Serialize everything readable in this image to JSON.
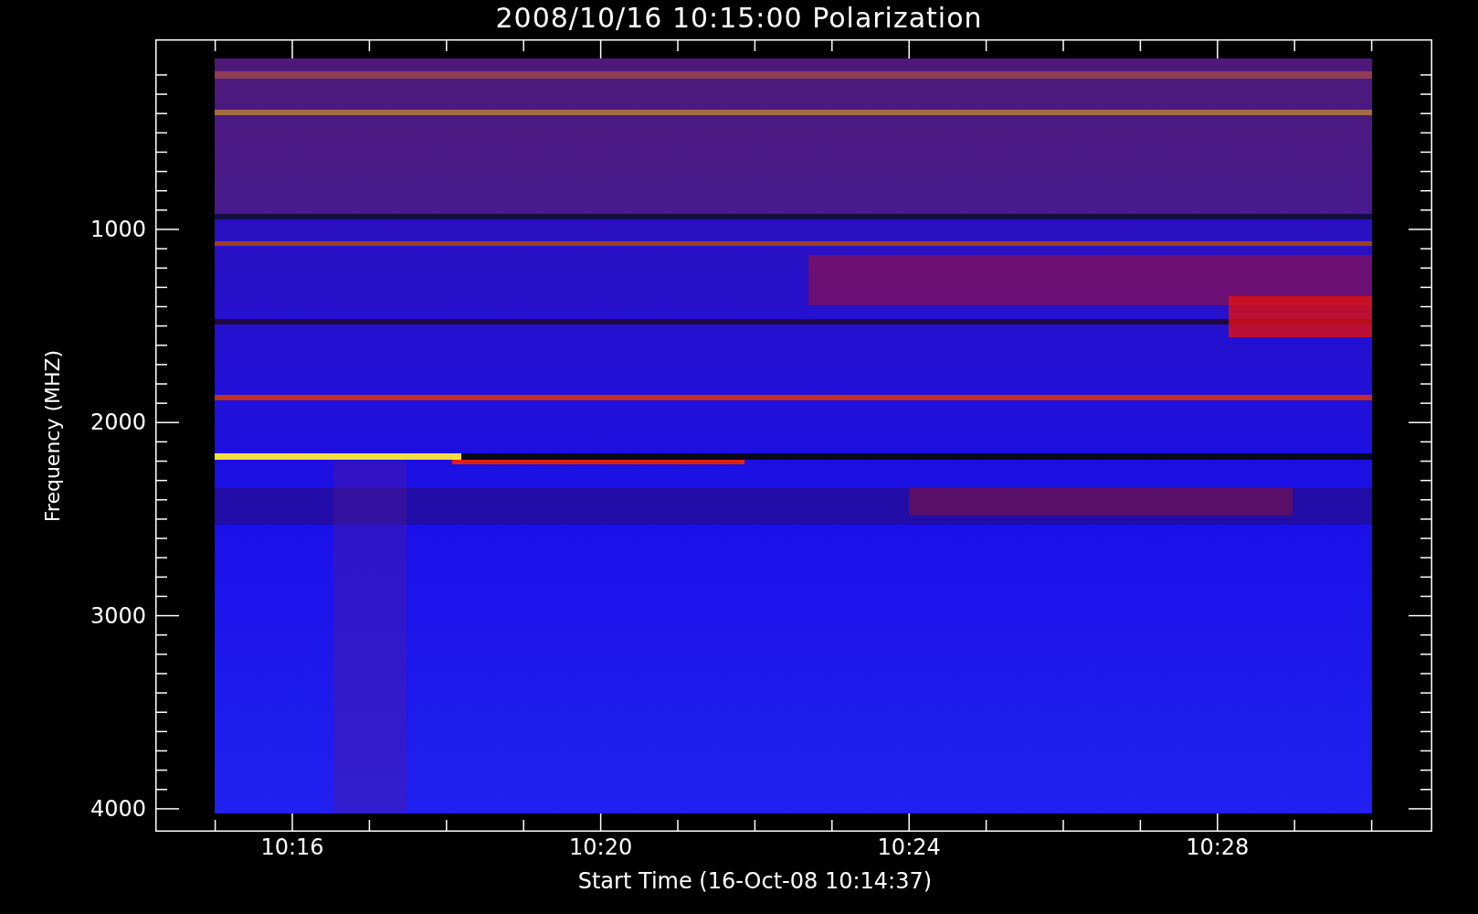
{
  "title": "2008/10/16 10:15:00 Polarization",
  "y_axis": {
    "label": "Frequency (MHZ)",
    "ticks": [
      "1000",
      "2000",
      "3000",
      "4000"
    ]
  },
  "x_axis": {
    "label": "Start Time (16-Oct-08 10:14:37)",
    "ticks": [
      "10:16",
      "10:20",
      "10:24",
      "10:28"
    ]
  }
}
